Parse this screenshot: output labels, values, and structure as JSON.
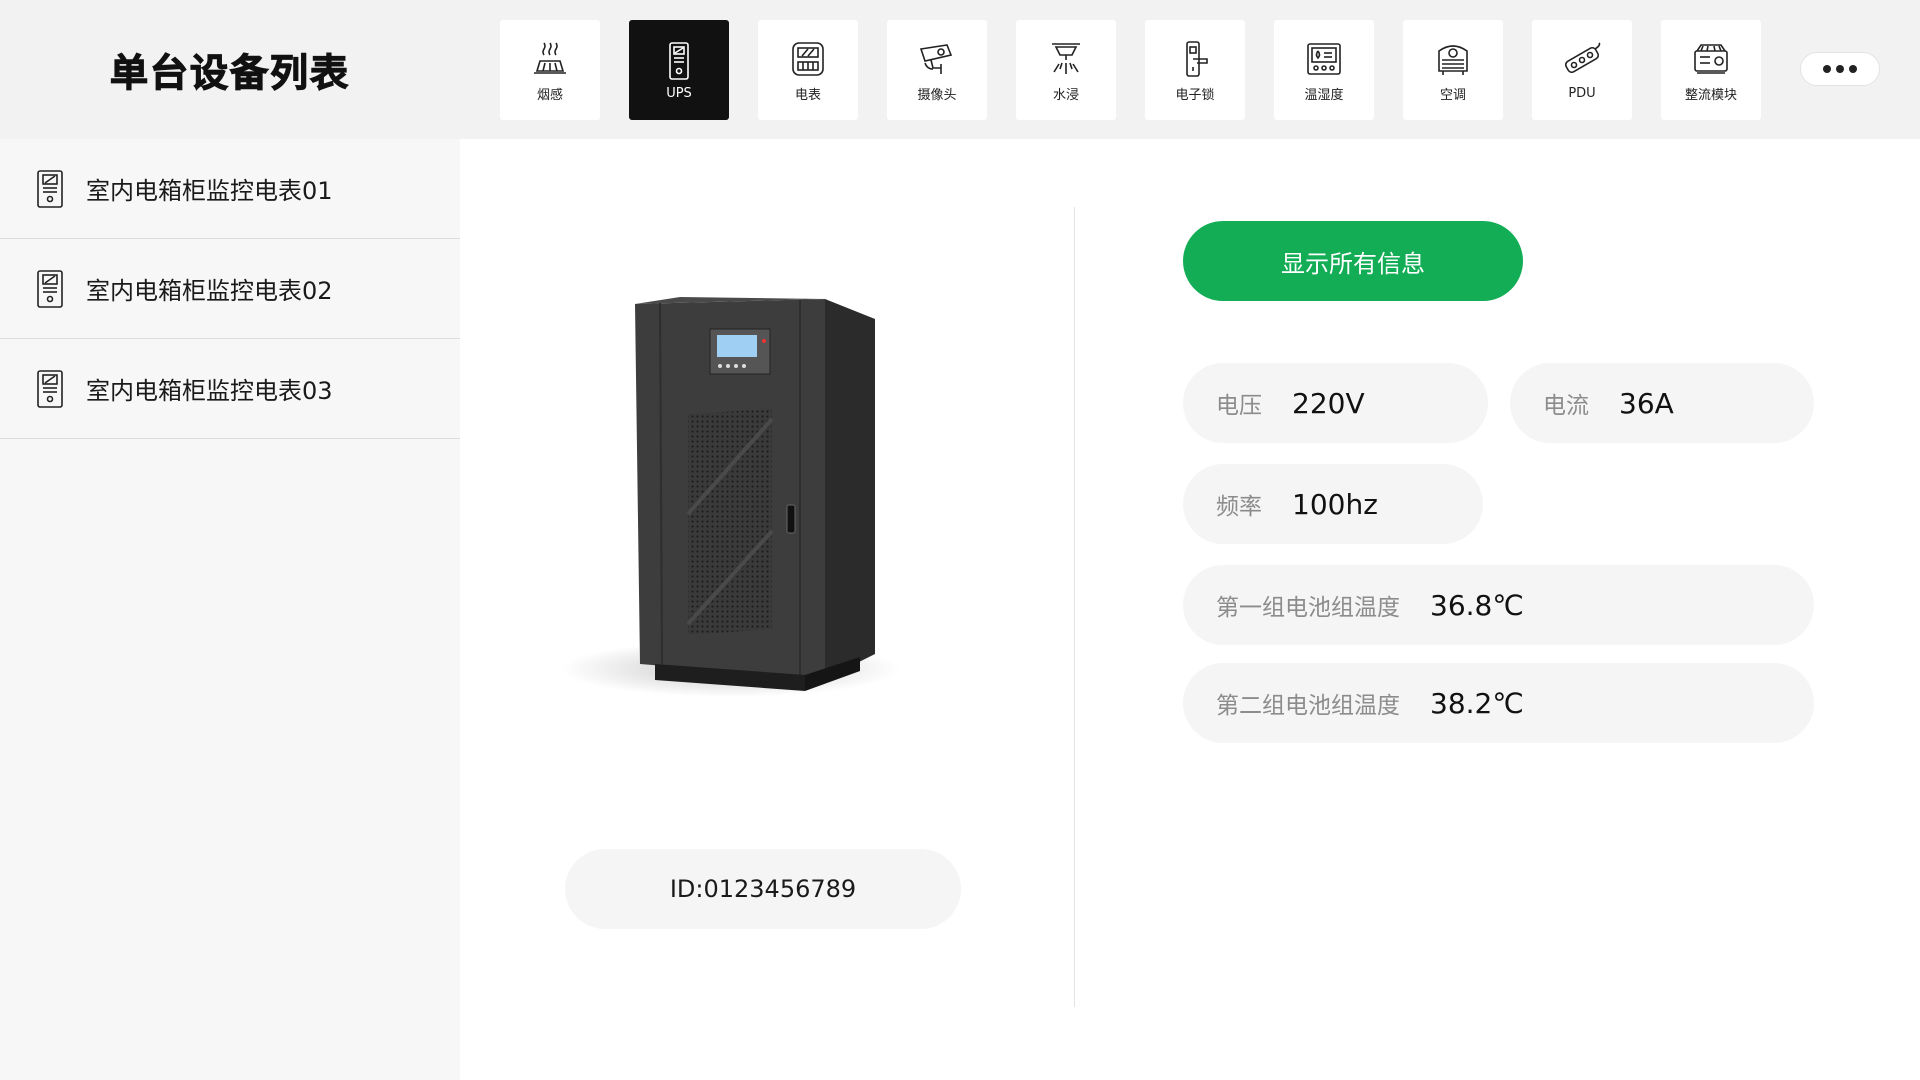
{
  "sidebar": {
    "title": "单台设备列表",
    "items": [
      {
        "label": "室内电箱柜监控电表01",
        "icon": "ups-device-icon"
      },
      {
        "label": "室内电箱柜监控电表02",
        "icon": "ups-device-icon"
      },
      {
        "label": "室内电箱柜监控电表03",
        "icon": "ups-device-icon"
      }
    ]
  },
  "nav": {
    "items": [
      {
        "label": "烟感",
        "icon": "smoke-detector-icon",
        "active": false
      },
      {
        "label": "UPS",
        "icon": "ups-icon",
        "active": true
      },
      {
        "label": "电表",
        "icon": "meter-icon",
        "active": false
      },
      {
        "label": "摄像头",
        "icon": "camera-icon",
        "active": false
      },
      {
        "label": "水浸",
        "icon": "water-leak-icon",
        "active": false
      },
      {
        "label": "电子锁",
        "icon": "door-lock-icon",
        "active": false
      },
      {
        "label": "温湿度",
        "icon": "temp-humidity-icon",
        "active": false
      },
      {
        "label": "空调",
        "icon": "air-conditioner-icon",
        "active": false
      },
      {
        "label": "PDU",
        "icon": "pdu-icon",
        "active": false
      },
      {
        "label": "整流模块",
        "icon": "rectifier-icon",
        "active": false
      }
    ],
    "more_icon": "more-dots-icon"
  },
  "device": {
    "id_text": "ID:0123456789",
    "image": "ups-cabinet-image"
  },
  "actions": {
    "show_all_label": "显示所有信息"
  },
  "metrics": {
    "voltage": {
      "label": "电压",
      "value": "220V"
    },
    "current": {
      "label": "电流",
      "value": "36A"
    },
    "frequency": {
      "label": "频率",
      "value": "100hz"
    },
    "battery1": {
      "label": "第一组电池组温度",
      "value": "36.8℃"
    },
    "battery2": {
      "label": "第二组电池组温度",
      "value": "38.2℃"
    }
  },
  "colors": {
    "accent": "#12ad55",
    "active_nav": "#111111",
    "sidebar_bg": "#f7f7f7",
    "pill_bg": "#f5f5f5"
  }
}
